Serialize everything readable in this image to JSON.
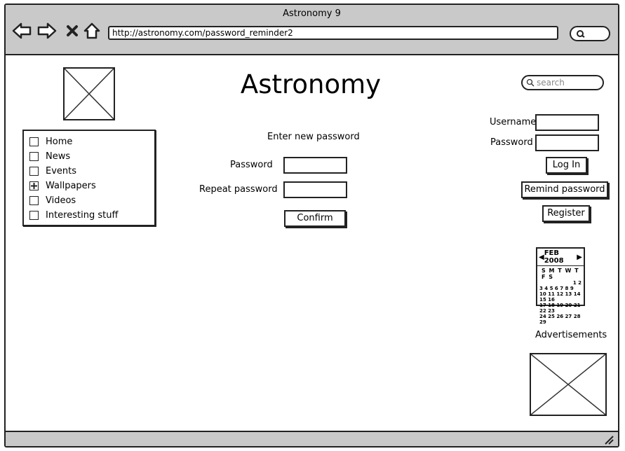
{
  "window": {
    "title": "Astronomy 9"
  },
  "browser": {
    "url": "http://astronomy.com/password_reminder2"
  },
  "site": {
    "title": "Astronomy"
  },
  "search": {
    "placeholder": "search"
  },
  "menu": {
    "items": [
      {
        "label": "Home",
        "checked": false
      },
      {
        "label": "News",
        "checked": false
      },
      {
        "label": "Events",
        "checked": false
      },
      {
        "label": "Wallpapers",
        "checked": true
      },
      {
        "label": "Videos",
        "checked": false
      },
      {
        "label": "Interesting stuff",
        "checked": false
      }
    ]
  },
  "form": {
    "heading": "Enter new password",
    "password_label": "Password",
    "repeat_label": "Repeat password",
    "confirm_label": "Confirm"
  },
  "login": {
    "username_label": "Username",
    "password_label": "Password",
    "login_label": "Log In",
    "remind_label": "Remind password",
    "register_label": "Register"
  },
  "calendar": {
    "header": "FEB 2008",
    "weekdays": "S M T W T F S",
    "rows": [
      "1 2",
      "3 4 5 6 7 8 9",
      "10 11 12 13 14 15 16",
      "17 18 19 20 21 22 23",
      "24 25 26 27 28 29"
    ]
  },
  "ads": {
    "label": "Advertisements"
  }
}
